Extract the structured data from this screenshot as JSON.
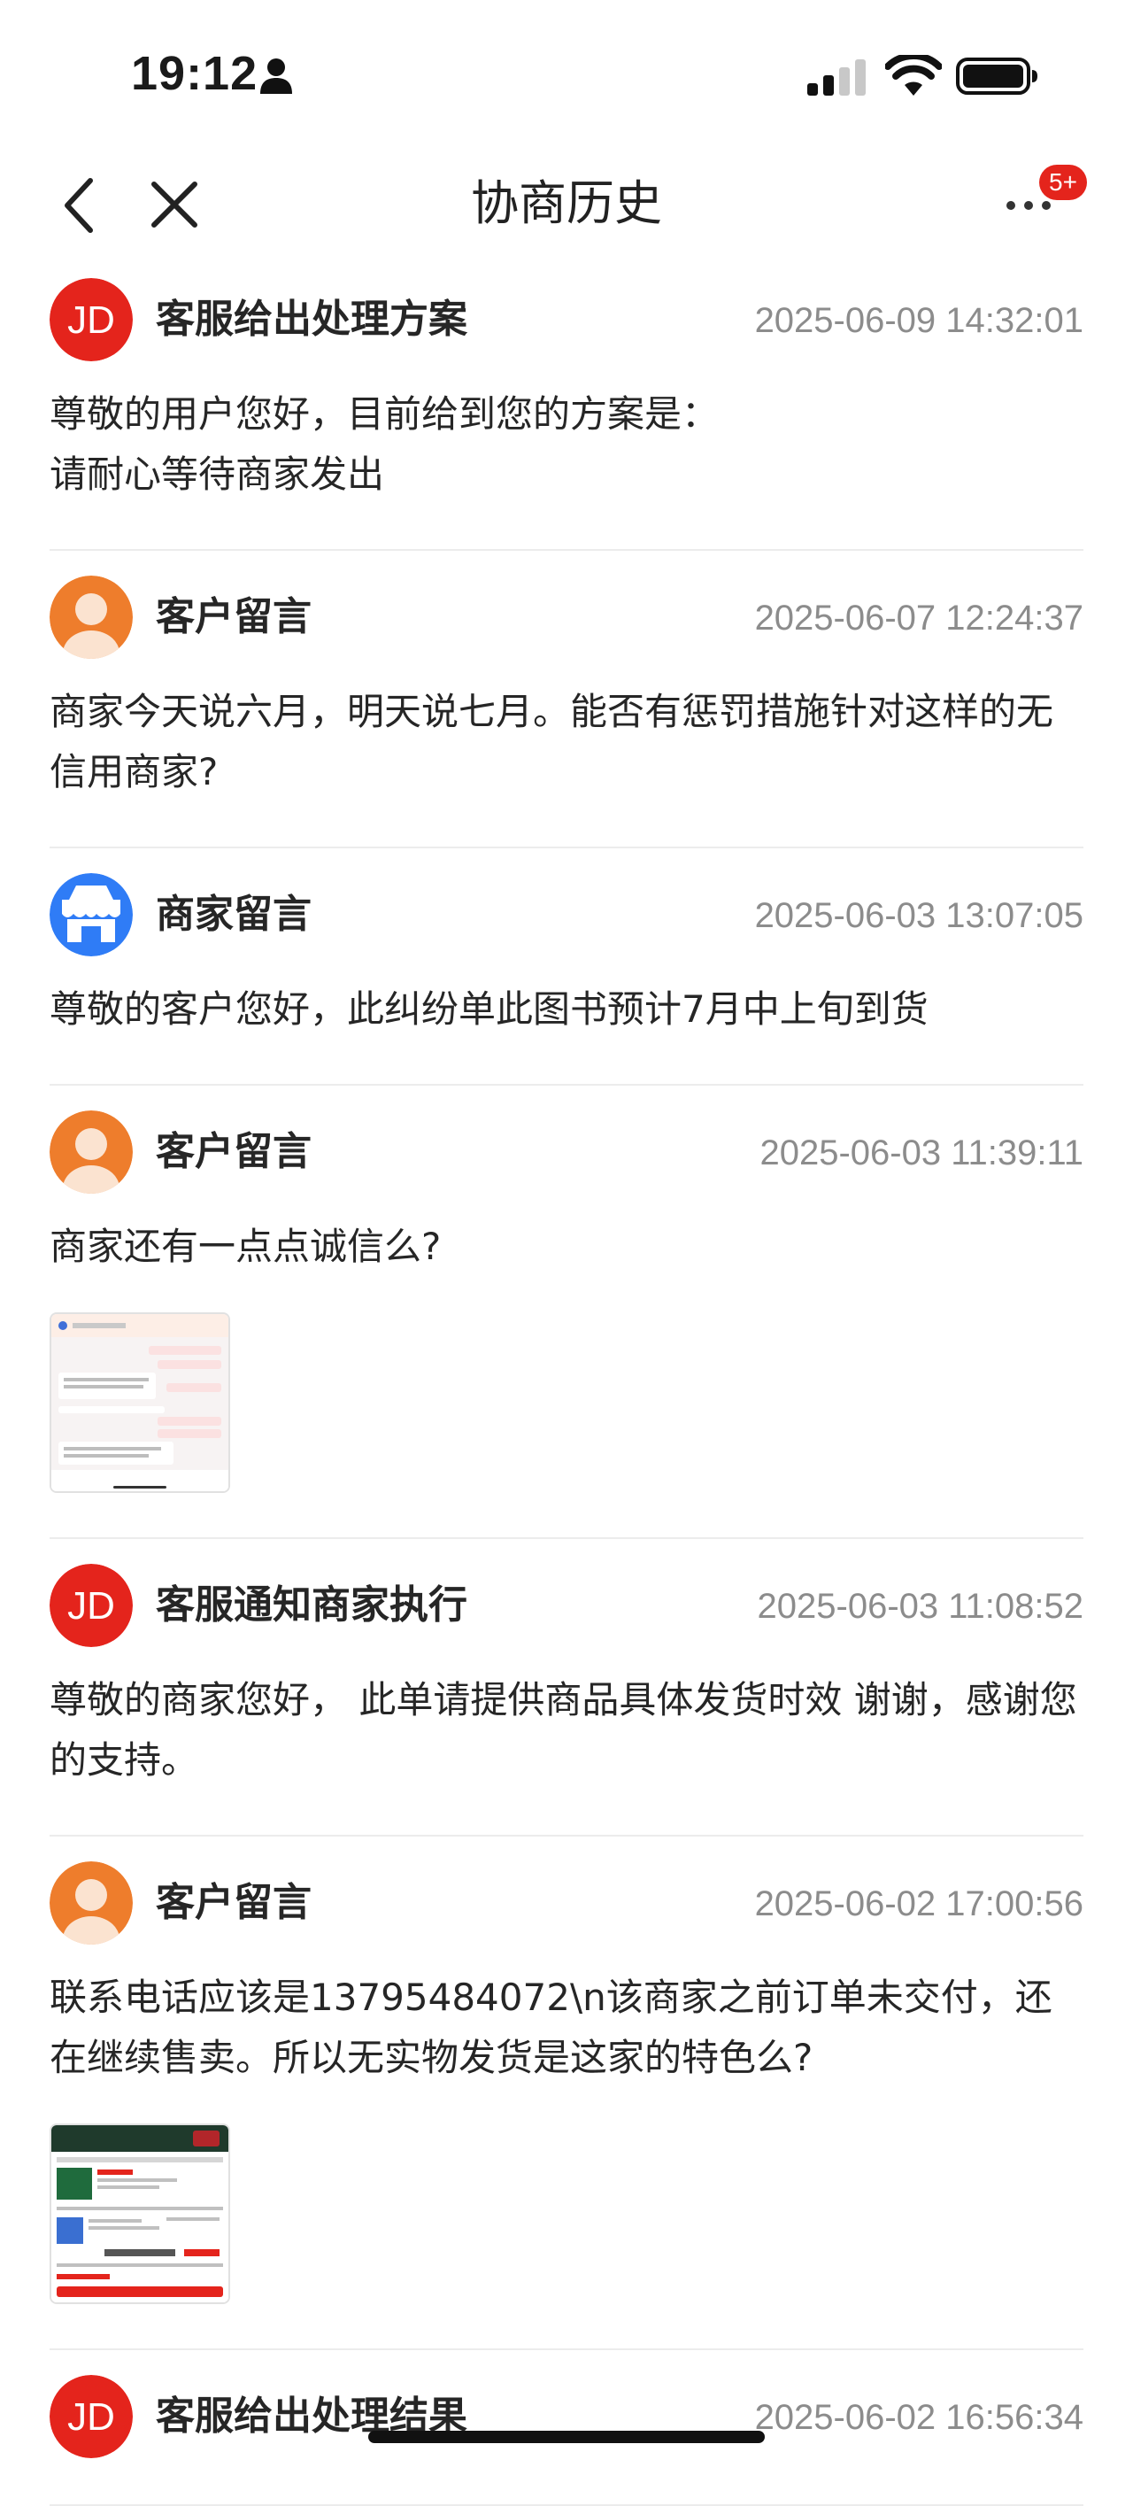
{
  "status_bar": {
    "time": "19:12",
    "icons": [
      "person-icon",
      "cellular-signal-icon",
      "wifi-icon",
      "battery-icon"
    ]
  },
  "nav": {
    "title": "协商历史",
    "back_icon": "chevron-left-icon",
    "close_icon": "close-icon",
    "more_icon": "more-dots-icon",
    "badge": "5+"
  },
  "colors": {
    "jd_red": "#e4241c",
    "customer_orange": "#ee7d2c",
    "merchant_blue": "#2f7cf6",
    "time_gray": "#8c8c8c",
    "divider": "#ececec"
  },
  "entries": [
    {
      "avatar": "jd-logo",
      "author": "客服给出处理方案",
      "time": "2025-06-09 14:32:01",
      "text": "尊敬的用户您好，目前给到您的方案是：\n请耐心等待商家发出"
    },
    {
      "avatar": "customer-avatar",
      "author": "客户留言",
      "time": "2025-06-07 12:24:37",
      "text": "商家今天说六月，明天说七月。能否有惩罚措施针对这样的无信用商家?"
    },
    {
      "avatar": "store-icon",
      "author": "商家留言",
      "time": "2025-06-03 13:07:05",
      "text": "尊敬的客户您好，此纠纷单此图书预计7月中上旬到货"
    },
    {
      "avatar": "customer-avatar",
      "author": "客户留言",
      "time": "2025-06-03 11:39:11",
      "text": "商家还有一点点诚信么?",
      "attachment": "chat-screenshot-thumbnail"
    },
    {
      "avatar": "jd-logo",
      "author": "客服通知商家执行",
      "time": "2025-06-03 11:08:52",
      "text": "尊敬的商家您好， 此单请提供商品具体发货时效 谢谢，感谢您的支持。"
    },
    {
      "avatar": "customer-avatar",
      "author": "客户留言",
      "time": "2025-06-02 17:00:56",
      "text": "联系电话应该是13795484072\\n该商家之前订单未交付，还在继续售卖。所以无实物发货是这家的特色么?",
      "attachment": "order-screenshot-thumbnail"
    },
    {
      "avatar": "jd-logo",
      "author": "客服给出处理结果",
      "time": "2025-06-02 16:56:34",
      "text": ""
    }
  ]
}
